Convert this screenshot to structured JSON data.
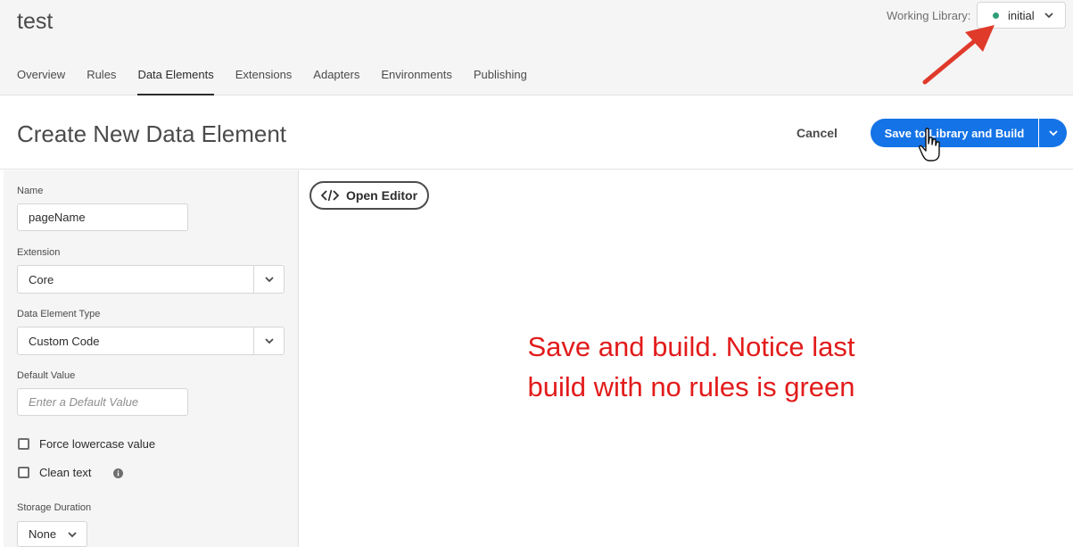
{
  "header": {
    "property_title": "test",
    "working_library_label": "Working Library:",
    "working_library_value": "initial",
    "library_status_color": "#2d9d78",
    "tabs": [
      {
        "label": "Overview"
      },
      {
        "label": "Rules"
      },
      {
        "label": "Data Elements",
        "active": true
      },
      {
        "label": "Extensions"
      },
      {
        "label": "Adapters"
      },
      {
        "label": "Environments"
      },
      {
        "label": "Publishing"
      }
    ]
  },
  "subheader": {
    "title": "Create New Data Element",
    "cancel_label": "Cancel",
    "save_label": "Save to Library and Build",
    "accent_color": "#1473e6"
  },
  "form": {
    "name_label": "Name",
    "name_value": "pageName",
    "extension_label": "Extension",
    "extension_value": "Core",
    "type_label": "Data Element Type",
    "type_value": "Custom Code",
    "default_label": "Default Value",
    "default_placeholder": "Enter a Default Value",
    "force_lowercase_label": "Force lowercase value",
    "force_lowercase_checked": false,
    "clean_text_label": "Clean text",
    "clean_text_checked": false,
    "storage_label": "Storage Duration",
    "storage_value": "None"
  },
  "editor": {
    "open_editor_label": "Open Editor"
  },
  "annotation": {
    "line1": "Save and build. Notice last",
    "line2": "build with no rules is green",
    "color": "#e21b1b"
  },
  "icons": {
    "chevron": "chevron-down-icon",
    "code": "code-icon",
    "info": "info-icon",
    "arrow": "annotation-arrow",
    "cursor": "hand-pointer-cursor"
  }
}
